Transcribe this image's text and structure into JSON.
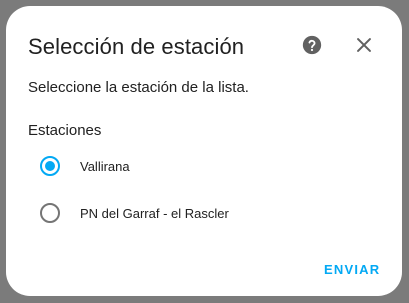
{
  "dialog": {
    "title": "Selección de estación",
    "description": "Seleccione la estación de la lista.",
    "group_label": "Estaciones",
    "options": [
      {
        "label": "Vallirana",
        "selected": true
      },
      {
        "label": "PN del Garraf - el Rascler",
        "selected": false
      }
    ],
    "submit_label": "ENVIAR",
    "icons": {
      "help": "help-circle-icon",
      "close": "close-icon"
    }
  },
  "colors": {
    "accent": "#03a9f4",
    "text": "#212121",
    "icon": "#616161",
    "backdrop": "#7b7b7b"
  }
}
